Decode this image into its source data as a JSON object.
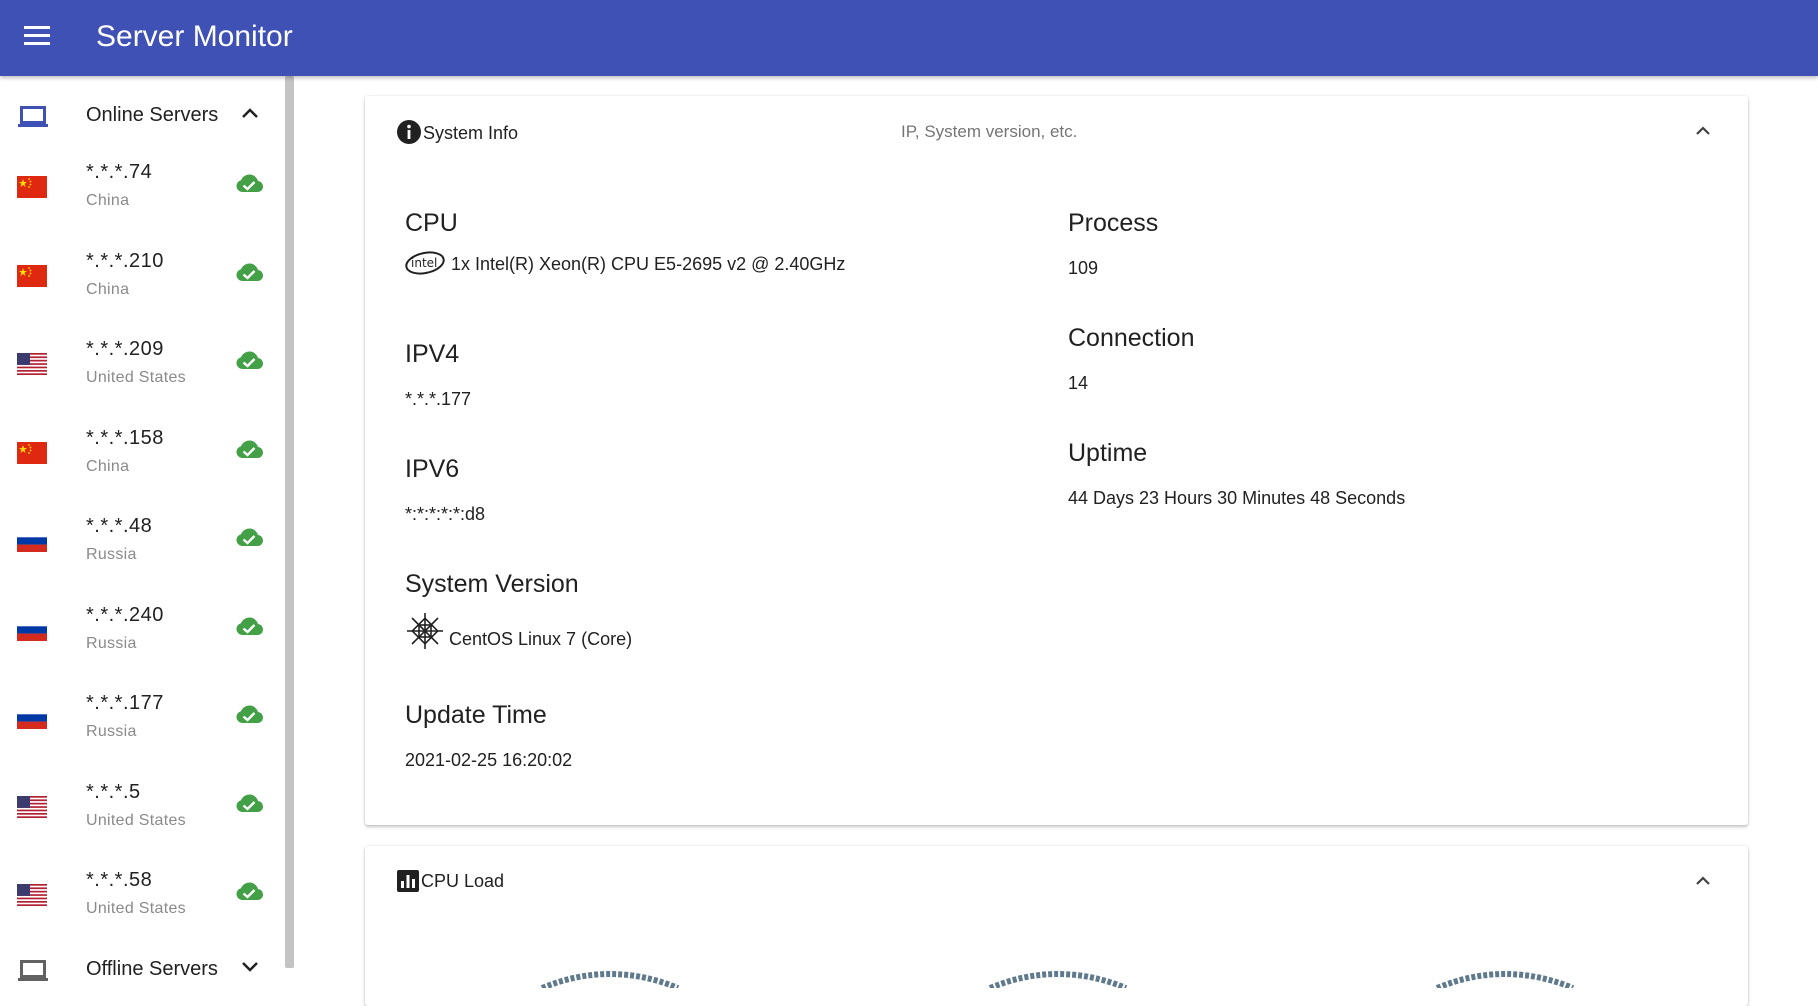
{
  "app": {
    "title": "Server Monitor"
  },
  "sidebar": {
    "online_label": "Online Servers",
    "offline_label": "Offline Servers",
    "servers": [
      {
        "ip": "*.*.*.74",
        "country": "China",
        "flag": "cn"
      },
      {
        "ip": "*.*.*.210",
        "country": "China",
        "flag": "cn"
      },
      {
        "ip": "*.*.*.209",
        "country": "United States",
        "flag": "us"
      },
      {
        "ip": "*.*.*.158",
        "country": "China",
        "flag": "cn"
      },
      {
        "ip": "*.*.*.48",
        "country": "Russia",
        "flag": "ru"
      },
      {
        "ip": "*.*.*.240",
        "country": "Russia",
        "flag": "ru"
      },
      {
        "ip": "*.*.*.177",
        "country": "Russia",
        "flag": "ru"
      },
      {
        "ip": "*.*.*.5",
        "country": "United States",
        "flag": "us"
      },
      {
        "ip": "*.*.*.58",
        "country": "United States",
        "flag": "us"
      }
    ]
  },
  "system_info": {
    "title": "System Info",
    "subtitle": "IP, System version, etc.",
    "cpu_label": "CPU",
    "cpu_value": "1x Intel(R) Xeon(R) CPU E5-2695 v2 @ 2.40GHz",
    "ipv4_label": "IPV4",
    "ipv4_value": "*.*.*.177",
    "ipv6_label": "IPV6",
    "ipv6_value": "*:*:*:*:*:d8",
    "sysver_label": "System Version",
    "sysver_value": "CentOS Linux 7 (Core)",
    "update_label": "Update Time",
    "update_value": "2021-02-25 16:20:02",
    "process_label": "Process",
    "process_value": "109",
    "connection_label": "Connection",
    "connection_value": "14",
    "uptime_label": "Uptime",
    "uptime_value": "44 Days 23 Hours 30 Minutes 48 Seconds"
  },
  "cpu_load": {
    "title": "CPU Load"
  },
  "colors": {
    "primary": "#3f51b5",
    "online": "#43a047",
    "gauge": "#5f7a8c"
  }
}
